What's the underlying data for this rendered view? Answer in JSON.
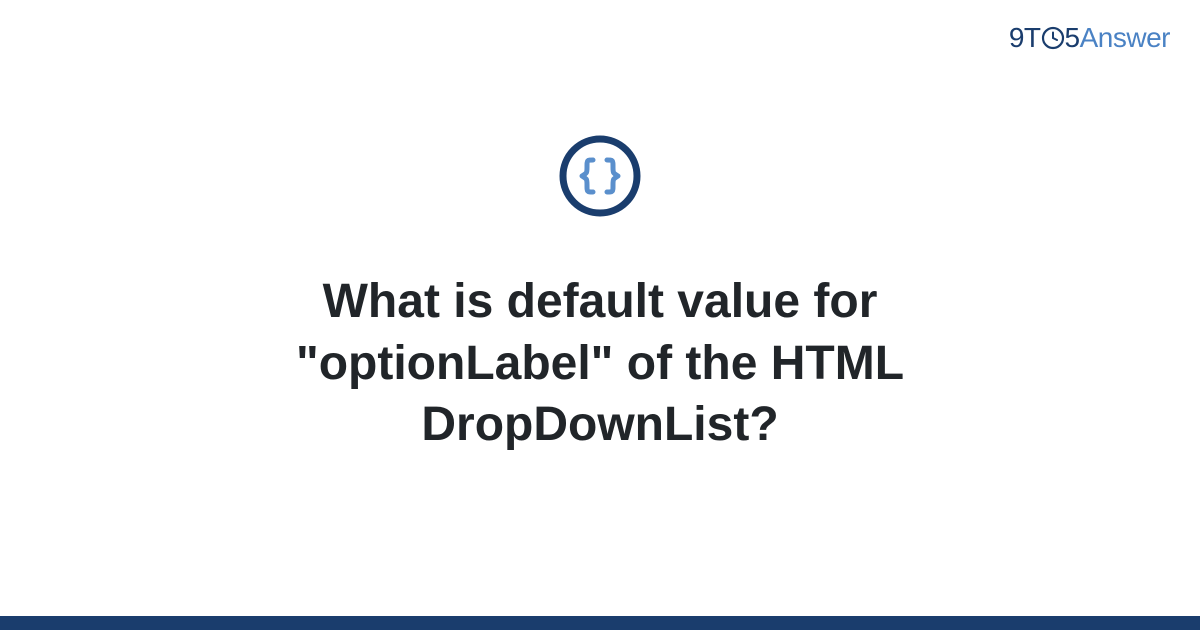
{
  "brand": {
    "part1": "9T",
    "part2": "5",
    "part3": "Answer"
  },
  "icon": {
    "name": "code-braces-icon"
  },
  "question": {
    "title": "What is default value for \"optionLabel\" of the HTML DropDownList?"
  },
  "colors": {
    "primary_dark": "#1a3d6d",
    "primary_light": "#4a82c4"
  }
}
